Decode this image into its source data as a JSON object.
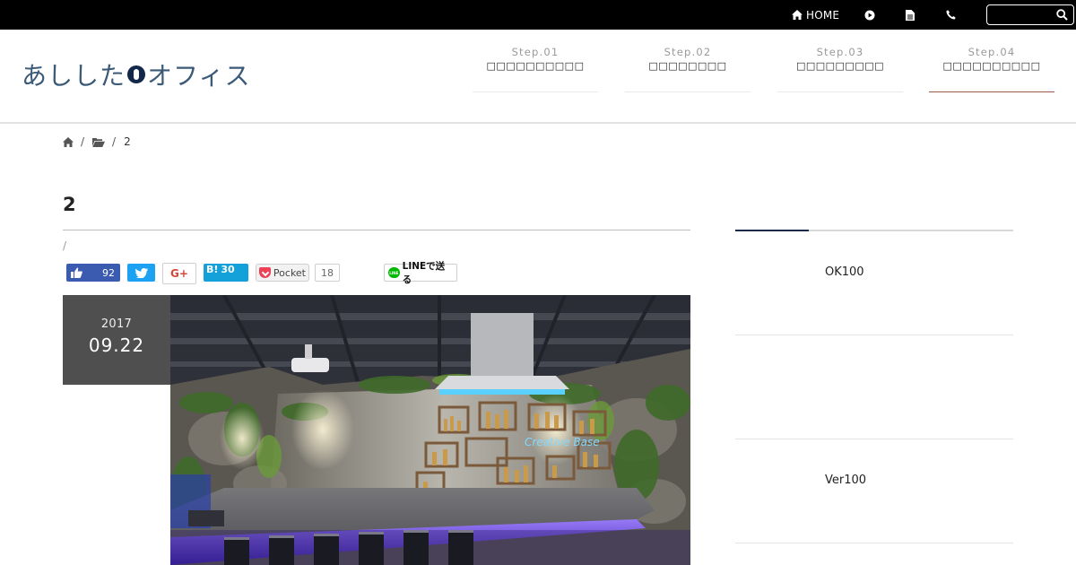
{
  "topbar": {
    "home_label": "HOME",
    "icons": [
      "home-icon",
      "play-circle-icon",
      "document-icon",
      "phone-icon",
      "search-icon"
    ],
    "search_value": ""
  },
  "header": {
    "logo_text_left": "あしした",
    "logo_text_right": "オフィス",
    "steps": [
      {
        "num": "Step.01",
        "name": "□□□□□□□□□□",
        "active": false
      },
      {
        "num": "Step.02",
        "name": "□□□□□□□□",
        "active": false
      },
      {
        "num": "Step.03",
        "name": "□□□□□□□□□",
        "active": false
      },
      {
        "num": "Step.04",
        "name": "□□□□□□□□□□",
        "active": true
      }
    ]
  },
  "breadcrumb": {
    "icons": [
      "home-icon",
      "folder-open-icon"
    ],
    "current": "2"
  },
  "post": {
    "title": "2",
    "meta": "/",
    "date_year": "2017",
    "date_md": "09.22",
    "share": {
      "facebook_count": "92",
      "google_label": "G+",
      "hatena_label": "B!",
      "hatena_count": "30",
      "pocket_label": "Pocket",
      "pocket_count": "18",
      "line_label": "LINEで送る"
    },
    "image_sign": "Creative Base"
  },
  "sidebar": {
    "items": [
      "OK100",
      "",
      "Ver100"
    ]
  },
  "colors": {
    "topbar_bg": "#000000",
    "logo": "#3b5a78",
    "active_step_underline": "#9b5a4a",
    "date_box_bg": "#4f4f4f",
    "sidebar_accent": "#1a2a4a"
  }
}
